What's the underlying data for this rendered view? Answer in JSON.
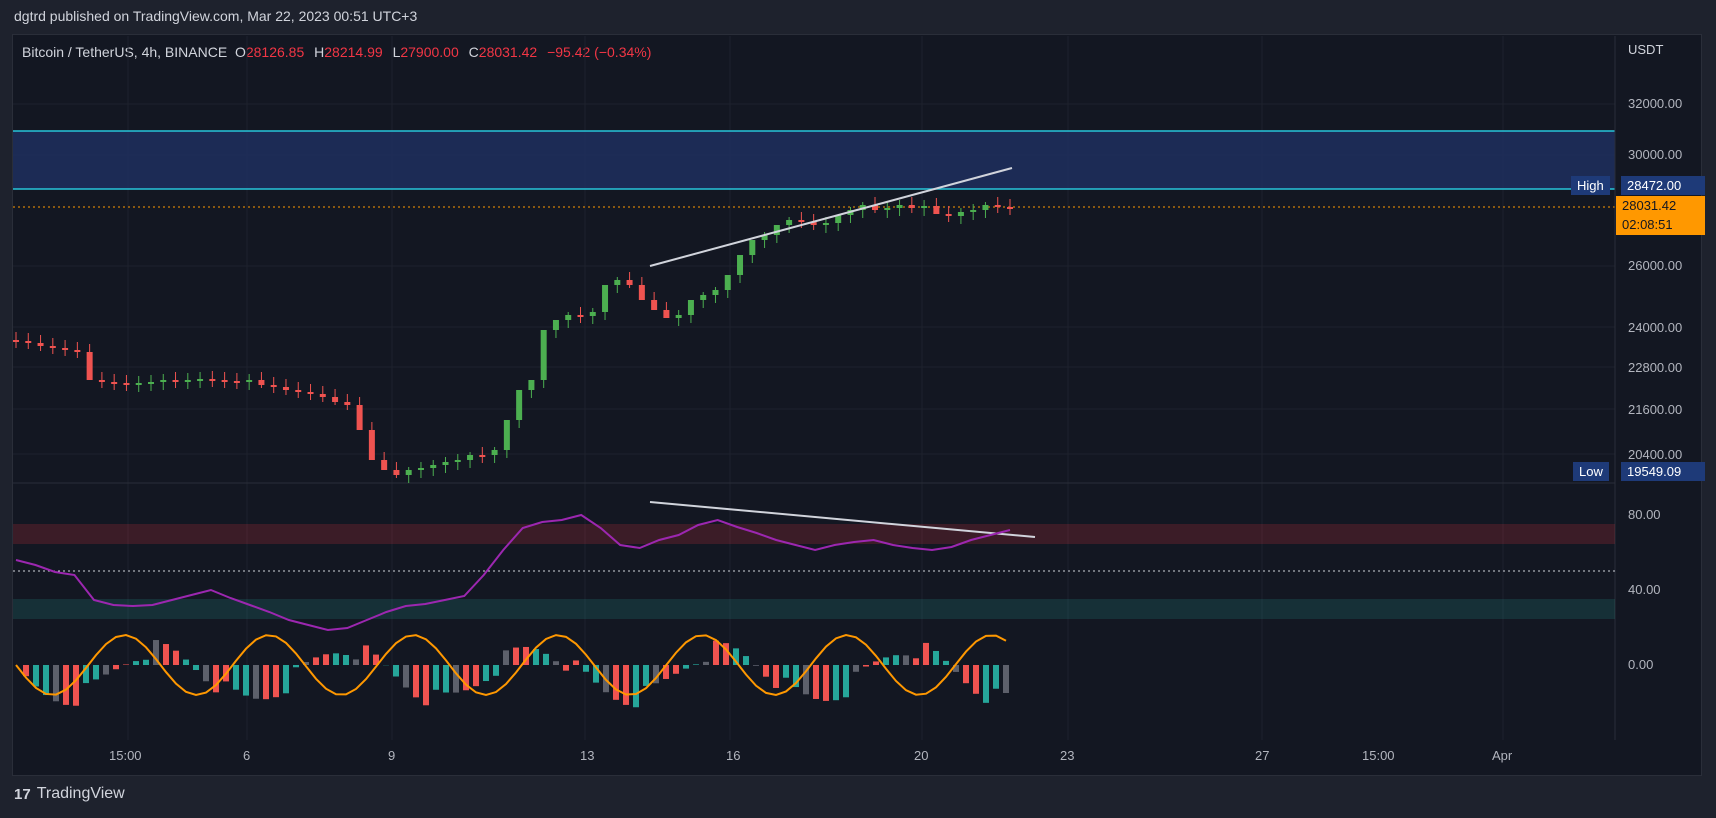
{
  "header": {
    "published_text": "dgtrd published on TradingView.com, Mar 22, 2023 00:51 UTC+3"
  },
  "legend": {
    "symbol": "Bitcoin / TetherUS, 4h, BINANCE",
    "open_label": "O",
    "open": "28126.85",
    "high_label": "H",
    "high": "28214.99",
    "low_label": "L",
    "low": "27900.00",
    "close_label": "C",
    "close": "28031.42",
    "change": "−95.42 (−0.34%)"
  },
  "price_scale": {
    "currency": "USDT",
    "ticks": [
      "32000.00",
      "30000.00",
      "26000.00",
      "24000.00",
      "22800.00",
      "21600.00",
      "20400.00"
    ],
    "high_label": "High",
    "high_value": "28472.00",
    "low_label": "Low",
    "low_value": "19549.09",
    "last_price": "28031.42",
    "countdown": "02:08:51"
  },
  "rsi_scale": {
    "ticks": [
      "80.00",
      "40.00"
    ]
  },
  "macd_scale": {
    "ticks": [
      "0.00"
    ]
  },
  "time_axis": {
    "ticks": [
      "15:00",
      "6",
      "9",
      "13",
      "16",
      "20",
      "23",
      "27",
      "15:00",
      "Apr"
    ]
  },
  "branding": {
    "logo_mark": "17",
    "name": "TradingView"
  },
  "colors": {
    "up": "#26a69a",
    "down": "#ef5350",
    "rsi": "#9c27b0",
    "signal": "#ff9800",
    "zone": "#1f2f5e"
  },
  "chart_data": {
    "type": "candlestick",
    "title": "Bitcoin / TetherUS, 4h, BINANCE",
    "price_unit": "USDT",
    "session_high": 28472.0,
    "session_low": 19549.09,
    "last": 28031.42,
    "rsi_overbought": 70,
    "rsi_oversold": 30
  }
}
